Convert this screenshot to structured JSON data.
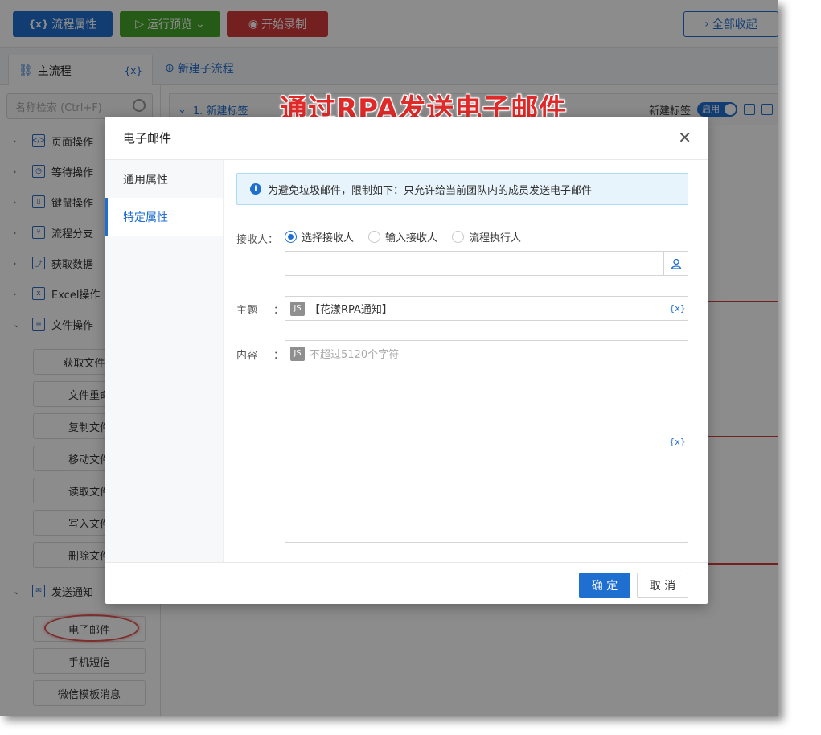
{
  "toolbar": {
    "flow_props": "流程属性",
    "run_preview": "运行预览",
    "start_record": "开始录制",
    "collapse_all": "全部收起",
    "flow_props_icon": "{x}"
  },
  "tabs": {
    "main_flow": "主流程",
    "var_icon": "{x}",
    "new_subflow": "新建子流程"
  },
  "sidebar": {
    "search_placeholder": "名称检索 (Ctrl+F)",
    "categories": [
      {
        "label": "页面操作",
        "icon": "page-icon"
      },
      {
        "label": "等待操作",
        "icon": "timer-icon"
      },
      {
        "label": "键鼠操作",
        "icon": "mouse-icon"
      },
      {
        "label": "流程分支",
        "icon": "branch-icon"
      },
      {
        "label": "获取数据",
        "icon": "chart-icon"
      },
      {
        "label": "Excel操作",
        "icon": "excel-icon"
      },
      {
        "label": "文件操作",
        "icon": "file-icon"
      }
    ],
    "file_items": [
      "获取文件列",
      "文件重命",
      "复制文件",
      "移动文件",
      "读取文件",
      "写入文件",
      "删除文件"
    ],
    "notify_category": "发送通知",
    "notify_items": [
      "电子邮件",
      "手机短信",
      "微信模板消息"
    ]
  },
  "main": {
    "row_title": "1. 新建标签",
    "row_label": "新建标签",
    "toggle_text": "启用"
  },
  "banner": "通过RPA发送电子邮件",
  "modal": {
    "title": "电子邮件",
    "nav": [
      "通用属性",
      "特定属性"
    ],
    "notice": "为避免垃圾邮件，限制如下：只允许给当前团队内的成员发送电子邮件",
    "receiver_label": "接收人：",
    "radio_options": [
      "选择接收人",
      "输入接收人",
      "流程执行人"
    ],
    "subject_label": "主题",
    "subject_value": "【花漾RPA通知】",
    "content_label": "内容",
    "content_placeholder": "不超过5120个字符",
    "var_btn": "{x}",
    "js_badge": "JS",
    "colon": "：",
    "ok": "确 定",
    "cancel": "取 消"
  }
}
